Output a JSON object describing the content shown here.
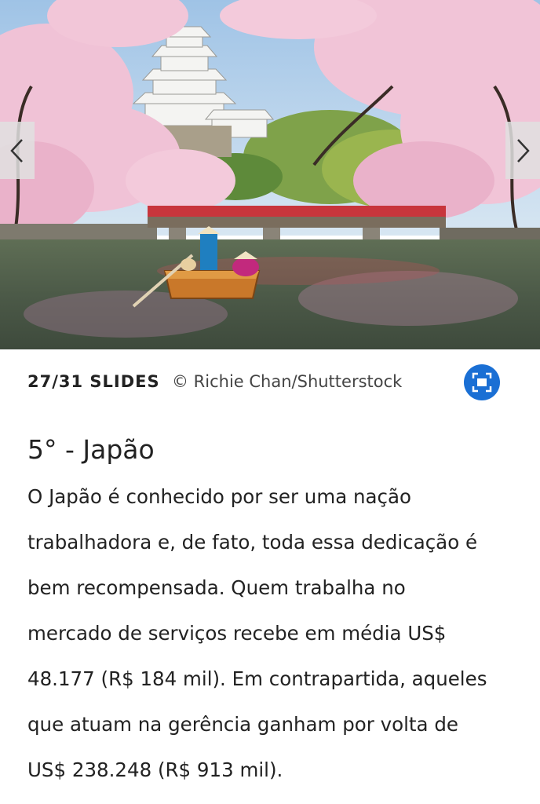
{
  "slideshow": {
    "counter": "27/31 SLIDES",
    "credit": "© Richie Chan/Shutterstock",
    "prev_icon": "chevron-left-icon",
    "next_icon": "chevron-right-icon",
    "fullscreen_icon": "fullscreen-icon",
    "accent_color": "#1a6fd4"
  },
  "article": {
    "title": "5° - Japão",
    "lines": [
      "O Japão é conhecido por ser uma nação",
      "trabalhadora e, de fato, toda essa dedicação é",
      "bem recompensada. Quem trabalha no",
      "mercado de serviços recebe em média US$",
      "48.177 (R$ 184 mil). Em contrapartida, aqueles",
      "que atuam na gerência ganham por volta de",
      "US$ 238.248 (R$ 913 mil)."
    ]
  }
}
